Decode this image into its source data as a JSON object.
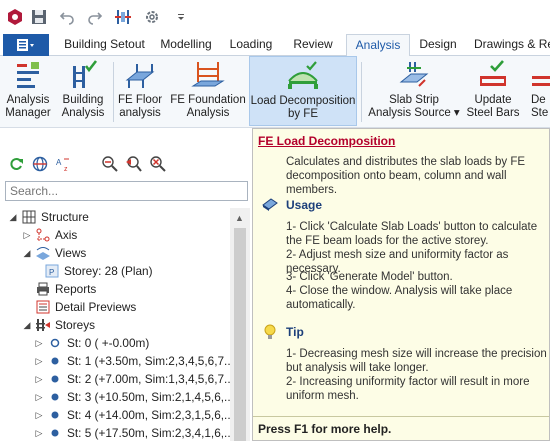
{
  "quick_access": {
    "icons": [
      "app-logo-icon",
      "save-icon",
      "undo-icon",
      "redo-icon",
      "structure-model-icon",
      "settings-icon",
      "customize-dropdown-icon"
    ]
  },
  "tabs": {
    "file_label": "",
    "items": [
      "Building Setout",
      "Modelling",
      "Loading",
      "Review",
      "Analysis",
      "Design",
      "Drawings & Re"
    ],
    "active": "Analysis"
  },
  "ribbon": {
    "analysis_manager": "Analysis\nManager",
    "building_analysis": "Building\nAnalysis",
    "fe_floor_analysis": "FE Floor\nanalysis",
    "fe_foundation_analysis": "FE Foundation\nAnalysis",
    "load_decomposition": "Load Decomposition\nby FE",
    "slab_strip_analysis_source": "Slab Strip\nAnalysis Source ▾",
    "update_steel_bars": "Update\nSteel Bars",
    "design_steel": "De\nSte"
  },
  "left_panel": {
    "search_placeholder": "Search...",
    "tree": [
      {
        "label": "Structure",
        "icon": "structure-grid-icon",
        "level": 0,
        "expander": "▲"
      },
      {
        "label": "Axis",
        "icon": "axis-icon",
        "level": 1,
        "expander": "▶"
      },
      {
        "label": "Views",
        "icon": "views-icon",
        "level": 1,
        "expander": "▲"
      },
      {
        "label": "Storey: 28 (Plan)",
        "icon": "plan-view-icon",
        "level": 2,
        "expander": ""
      },
      {
        "label": "Reports",
        "icon": "printer-icon",
        "level": 1,
        "expander": ""
      },
      {
        "label": "Detail Previews",
        "icon": "detail-preview-icon",
        "level": 1,
        "expander": ""
      },
      {
        "label": "Storeys",
        "icon": "storeys-icon",
        "level": 1,
        "expander": "▲"
      },
      {
        "label": "St: 0 ( +-0.00m)",
        "icon": "storey-dot-icon",
        "level": 2,
        "expander": "▶"
      },
      {
        "label": "St: 1 (+3.50m, Sim:2,3,4,5,6,7...",
        "icon": "storey-dot-icon",
        "level": 2,
        "expander": "▶"
      },
      {
        "label": "St: 2 (+7.00m, Sim:1,3,4,5,6,7...",
        "icon": "storey-dot-icon",
        "level": 2,
        "expander": "▶"
      },
      {
        "label": "St: 3 (+10.50m, Sim:2,1,4,5,6,...",
        "icon": "storey-dot-icon",
        "level": 2,
        "expander": "▶"
      },
      {
        "label": "St: 4 (+14.00m, Sim:2,3,1,5,6,...",
        "icon": "storey-dot-icon",
        "level": 2,
        "expander": "▶"
      },
      {
        "label": "St: 5 (+17.50m, Sim:2,3,4,1,6,...",
        "icon": "storey-dot-icon",
        "level": 2,
        "expander": "▶"
      }
    ]
  },
  "tooltip": {
    "title": "FE Load Decomposition",
    "description": "Calculates and distributes the slab loads by FE decomposition onto beam, column and wall members.",
    "usage_heading": "Usage",
    "usage_lines": [
      "1- Click 'Calculate Slab Loads' button to calculate the FE beam loads for the active storey.",
      "2- Adjust mesh size and uniformity factor as necessary.",
      "3- Click 'Generate Model' button.",
      "4- Close the window. Analysis will take place automatically."
    ],
    "tip_heading": "Tip",
    "tip_lines": [
      "1- Decreasing mesh size will increase the precision but analysis will take longer.",
      "2- Increasing uniformity factor will result in more uniform mesh."
    ],
    "footer": "Press F1 for more help."
  },
  "colors": {
    "accent": "#1e5aa8",
    "title_red": "#b3002b",
    "heading_blue": "#1c3f7a",
    "tooltip_bg": "#fdfde6",
    "ribbon_highlight": "#cfe2f7"
  }
}
